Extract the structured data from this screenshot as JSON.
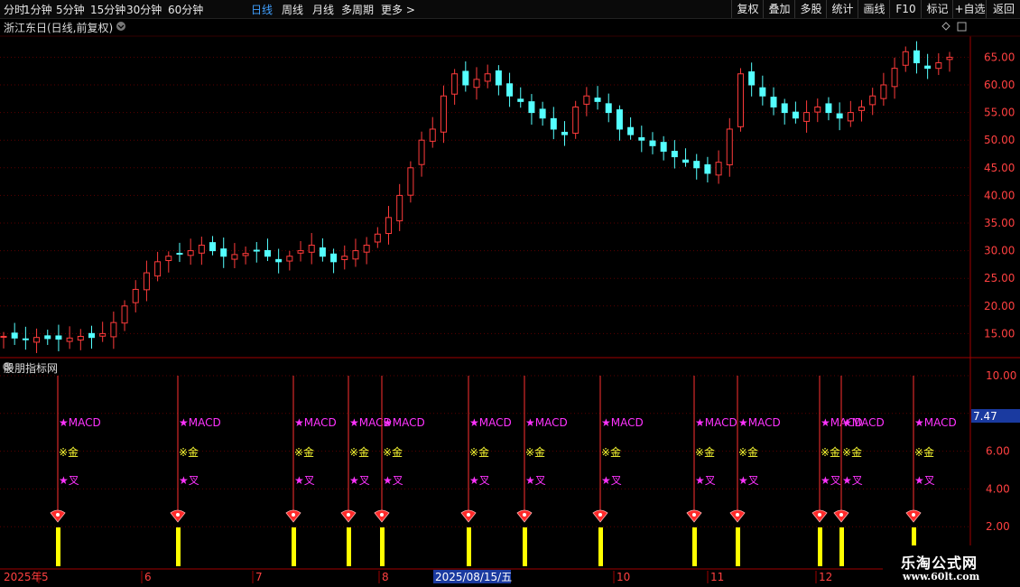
{
  "toolbar": {
    "left": [
      "分时",
      "1分钟",
      "5分钟",
      "15分钟",
      "30分钟",
      "60分钟",
      "日线",
      "周线",
      "月线",
      "多周期",
      "更多 >"
    ],
    "active": "日线",
    "right": [
      "复权",
      "叠加",
      "多股",
      "统计",
      "画线",
      "F10",
      "标记",
      "+自选",
      "返回"
    ]
  },
  "main_chart": {
    "title": "浙江东日(日线,前复权)",
    "y_ticks": [
      "65.00",
      "60.00",
      "55.00",
      "50.00",
      "45.00",
      "40.00",
      "35.00",
      "30.00",
      "25.00",
      "20.00",
      "15.00"
    ],
    "y_values": [
      65,
      60,
      55,
      50,
      45,
      40,
      35,
      30,
      25,
      20,
      15
    ],
    "colors": {
      "up": "#ff3b3b",
      "down": "#54ffff",
      "grid": "#5a0000",
      "axis": "#a00000"
    }
  },
  "indicator": {
    "title": "股朋指标网",
    "y_ticks": [
      "10.00",
      "8.00",
      "6.00",
      "4.00",
      "2.00"
    ],
    "current_value": "7.47",
    "signal_labels": {
      "macd": "★MACD",
      "gold": "※金",
      "cross": "★叉"
    },
    "signal_count": 13
  },
  "date_axis": {
    "labels": [
      "2025年",
      "5",
      "6",
      "7",
      "8",
      "10",
      "11",
      "12"
    ],
    "cursor_date": "2025/08/15/五"
  },
  "watermark": {
    "line1": "乐淘公式网",
    "line2": "www.60lt.com"
  },
  "chart_data": {
    "type": "candlestick",
    "title": "浙江东日(日线,前复权)",
    "y_range": [
      12,
      68
    ],
    "approx_close_path": [
      14.5,
      14.2,
      14.0,
      14.3,
      14.1,
      14.0,
      14.2,
      14.5,
      14.3,
      15,
      17,
      20,
      23,
      26,
      28,
      29,
      29.5,
      30,
      31,
      30,
      29,
      29.3,
      29.5,
      30,
      29,
      28,
      29,
      30,
      31,
      29,
      28,
      29,
      30,
      31,
      33,
      36,
      40,
      45,
      50,
      52,
      58,
      62,
      60,
      61,
      62,
      60,
      58,
      57,
      55,
      54,
      52,
      51,
      56,
      58,
      57,
      55,
      52,
      51,
      50,
      49,
      48,
      47,
      46,
      45,
      44,
      46,
      52,
      62,
      60,
      58,
      56,
      55,
      54,
      55,
      56,
      55,
      54,
      55,
      56,
      58,
      60,
      63,
      66,
      64,
      63,
      64,
      65
    ],
    "indicator_signals_x_index": [
      0,
      1,
      2,
      3,
      4,
      5,
      6,
      7,
      8,
      9,
      10,
      11,
      12
    ]
  }
}
